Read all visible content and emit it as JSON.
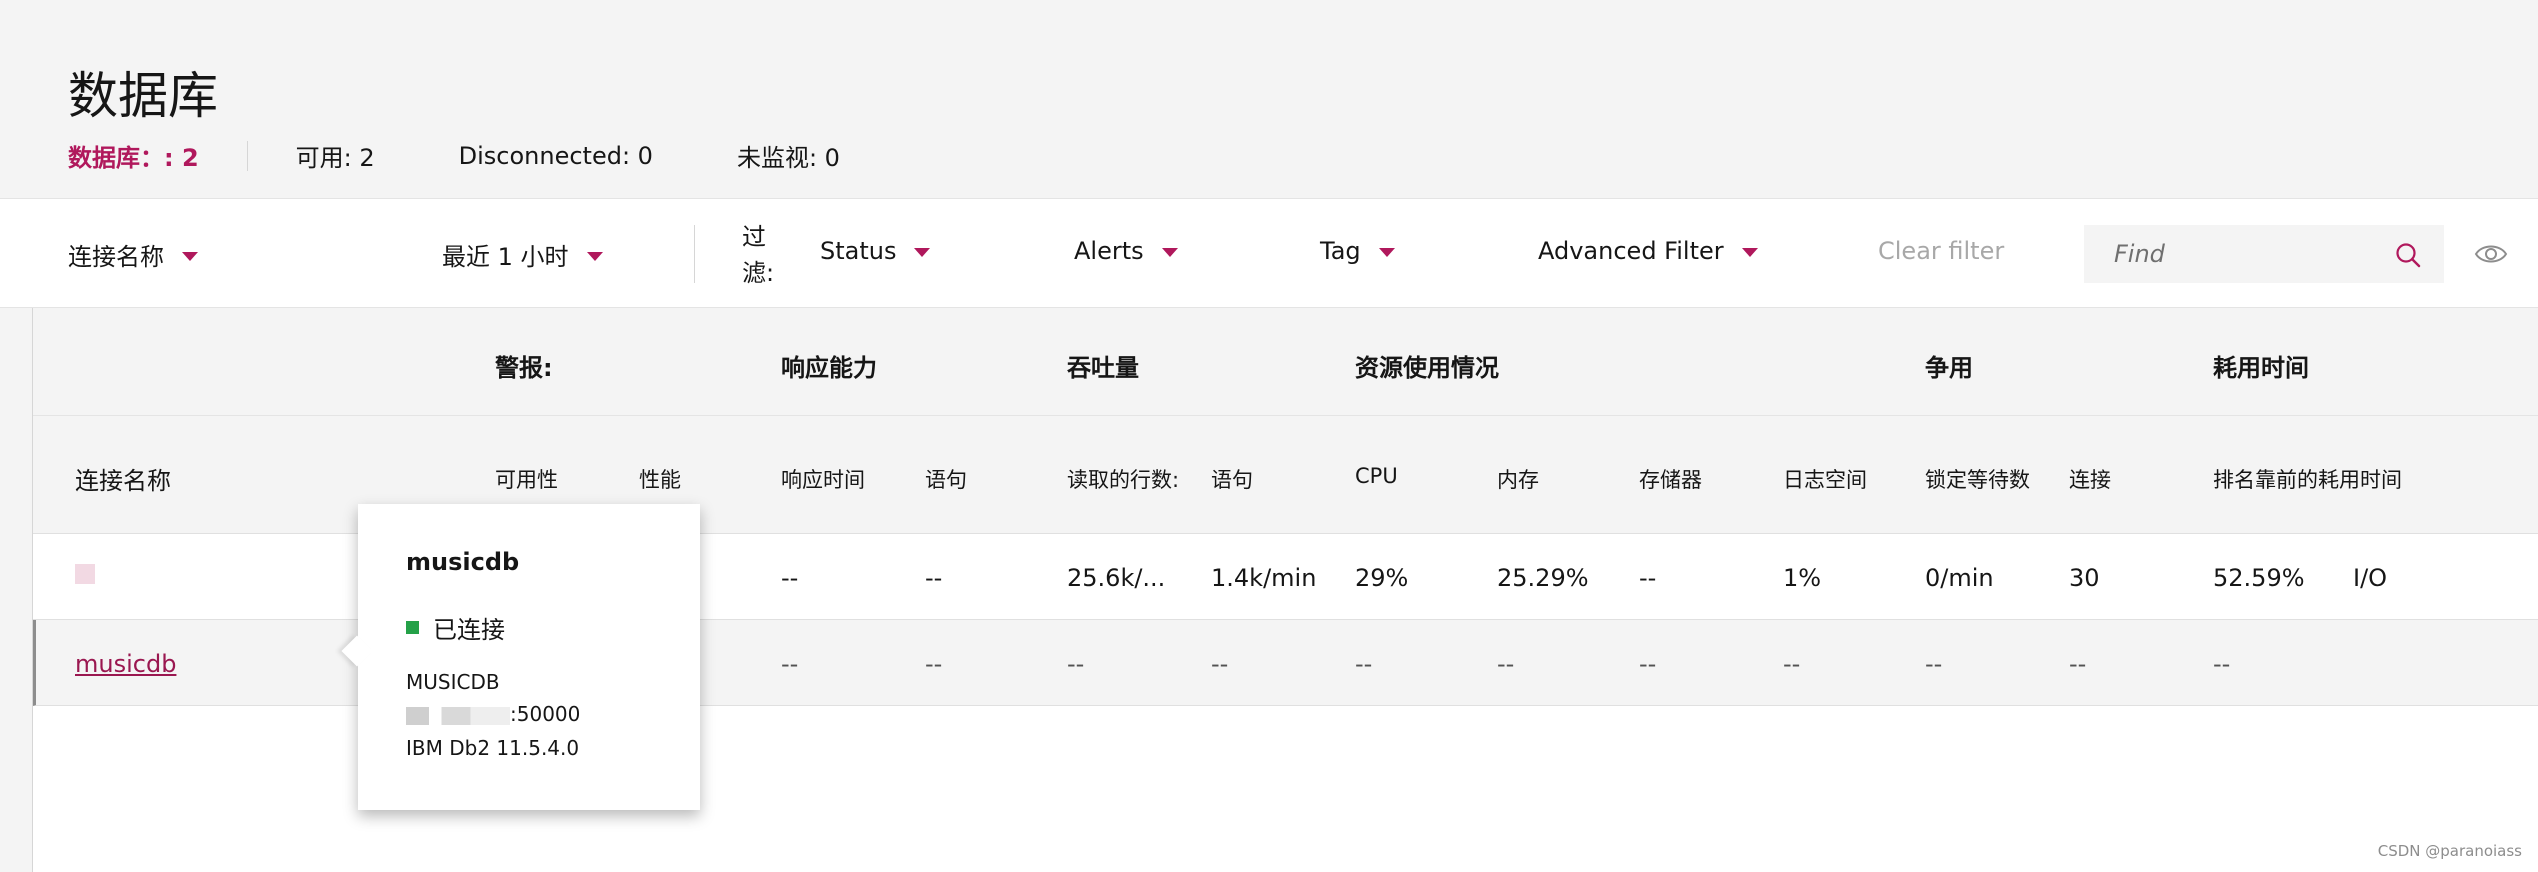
{
  "page": {
    "title": "数据库",
    "counts": {
      "databases": "数据库：: 2",
      "available": "可用: 2",
      "disconnected": "Disconnected: 0",
      "unmonitored": "未监视: 0"
    }
  },
  "filters": {
    "connection_name": "连接名称",
    "time_range": "最近 1 小时",
    "filter_label": "过滤:",
    "status": "Status",
    "alerts": "Alerts",
    "tag": "Tag",
    "advanced": "Advanced Filter",
    "clear": "Clear filter",
    "find_placeholder": "Find"
  },
  "table": {
    "groups": {
      "alerts": "警报:",
      "responsiveness": "响应能力",
      "throughput": "吞吐量",
      "resources": "资源使用情况",
      "contention": "争用",
      "time_spent": "耗用时间"
    },
    "columns": {
      "connection_name": "连接名称",
      "availability": "可用性",
      "performance": "性能",
      "response_time": "响应时间",
      "statements_resp": "语句",
      "rows_read": "读取的行数:",
      "statements_tput": "语句",
      "cpu": "CPU",
      "memory": "内存",
      "storage": "存储器",
      "log_space": "日志空间",
      "lock_waits": "锁定等待数",
      "connections": "连接",
      "top_time": "排名靠前的耗用时间"
    },
    "rows": [
      {
        "name": "",
        "response_time": "--",
        "statements_resp": "--",
        "rows_read": "25.6k/...",
        "statements_tput": "1.4k/min",
        "cpu": "29%",
        "memory": "25.29%",
        "storage": "--",
        "log_space": "1%",
        "lock_waits": "0/min",
        "connections": "30",
        "top_time": "52.59%",
        "top_time_type": "I/O"
      },
      {
        "name": "musicdb",
        "response_time": "--",
        "statements_resp": "--",
        "rows_read": "--",
        "statements_tput": "--",
        "cpu": "--",
        "memory": "--",
        "storage": "--",
        "log_space": "--",
        "lock_waits": "--",
        "connections": "--",
        "top_time": "--"
      }
    ]
  },
  "tooltip": {
    "title": "musicdb",
    "status": "已连接",
    "db_name": "MUSICDB",
    "port": ":50000",
    "product": "IBM Db2  11.5.4.0"
  },
  "watermark": "CSDN @paranoiass",
  "colors": {
    "accent": "#b0185c",
    "link": "#9a1750",
    "connected": "#24a148"
  }
}
